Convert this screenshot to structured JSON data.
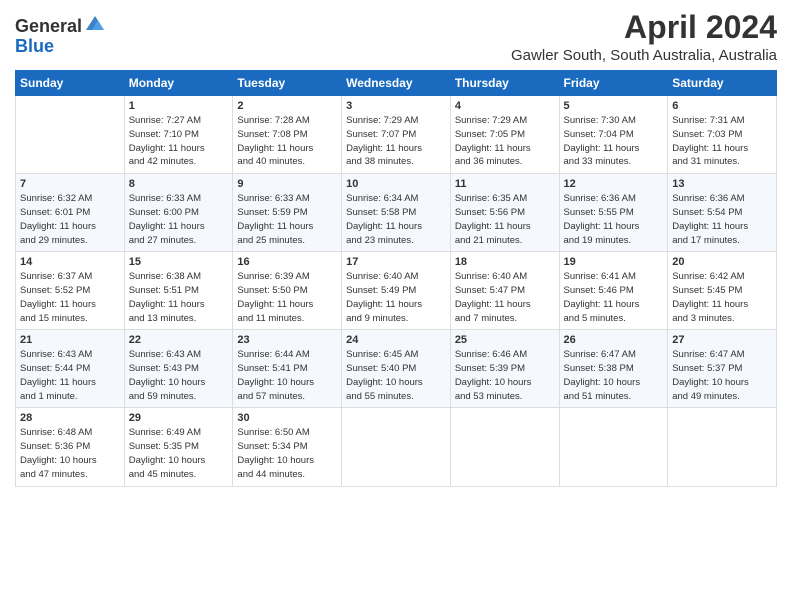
{
  "logo": {
    "general": "General",
    "blue": "Blue"
  },
  "title": "April 2024",
  "subtitle": "Gawler South, South Australia, Australia",
  "headers": [
    "Sunday",
    "Monday",
    "Tuesday",
    "Wednesday",
    "Thursday",
    "Friday",
    "Saturday"
  ],
  "weeks": [
    [
      {
        "day": "",
        "info": ""
      },
      {
        "day": "1",
        "info": "Sunrise: 7:27 AM\nSunset: 7:10 PM\nDaylight: 11 hours\nand 42 minutes."
      },
      {
        "day": "2",
        "info": "Sunrise: 7:28 AM\nSunset: 7:08 PM\nDaylight: 11 hours\nand 40 minutes."
      },
      {
        "day": "3",
        "info": "Sunrise: 7:29 AM\nSunset: 7:07 PM\nDaylight: 11 hours\nand 38 minutes."
      },
      {
        "day": "4",
        "info": "Sunrise: 7:29 AM\nSunset: 7:05 PM\nDaylight: 11 hours\nand 36 minutes."
      },
      {
        "day": "5",
        "info": "Sunrise: 7:30 AM\nSunset: 7:04 PM\nDaylight: 11 hours\nand 33 minutes."
      },
      {
        "day": "6",
        "info": "Sunrise: 7:31 AM\nSunset: 7:03 PM\nDaylight: 11 hours\nand 31 minutes."
      }
    ],
    [
      {
        "day": "7",
        "info": "Sunrise: 6:32 AM\nSunset: 6:01 PM\nDaylight: 11 hours\nand 29 minutes."
      },
      {
        "day": "8",
        "info": "Sunrise: 6:33 AM\nSunset: 6:00 PM\nDaylight: 11 hours\nand 27 minutes."
      },
      {
        "day": "9",
        "info": "Sunrise: 6:33 AM\nSunset: 5:59 PM\nDaylight: 11 hours\nand 25 minutes."
      },
      {
        "day": "10",
        "info": "Sunrise: 6:34 AM\nSunset: 5:58 PM\nDaylight: 11 hours\nand 23 minutes."
      },
      {
        "day": "11",
        "info": "Sunrise: 6:35 AM\nSunset: 5:56 PM\nDaylight: 11 hours\nand 21 minutes."
      },
      {
        "day": "12",
        "info": "Sunrise: 6:36 AM\nSunset: 5:55 PM\nDaylight: 11 hours\nand 19 minutes."
      },
      {
        "day": "13",
        "info": "Sunrise: 6:36 AM\nSunset: 5:54 PM\nDaylight: 11 hours\nand 17 minutes."
      }
    ],
    [
      {
        "day": "14",
        "info": "Sunrise: 6:37 AM\nSunset: 5:52 PM\nDaylight: 11 hours\nand 15 minutes."
      },
      {
        "day": "15",
        "info": "Sunrise: 6:38 AM\nSunset: 5:51 PM\nDaylight: 11 hours\nand 13 minutes."
      },
      {
        "day": "16",
        "info": "Sunrise: 6:39 AM\nSunset: 5:50 PM\nDaylight: 11 hours\nand 11 minutes."
      },
      {
        "day": "17",
        "info": "Sunrise: 6:40 AM\nSunset: 5:49 PM\nDaylight: 11 hours\nand 9 minutes."
      },
      {
        "day": "18",
        "info": "Sunrise: 6:40 AM\nSunset: 5:47 PM\nDaylight: 11 hours\nand 7 minutes."
      },
      {
        "day": "19",
        "info": "Sunrise: 6:41 AM\nSunset: 5:46 PM\nDaylight: 11 hours\nand 5 minutes."
      },
      {
        "day": "20",
        "info": "Sunrise: 6:42 AM\nSunset: 5:45 PM\nDaylight: 11 hours\nand 3 minutes."
      }
    ],
    [
      {
        "day": "21",
        "info": "Sunrise: 6:43 AM\nSunset: 5:44 PM\nDaylight: 11 hours\nand 1 minute."
      },
      {
        "day": "22",
        "info": "Sunrise: 6:43 AM\nSunset: 5:43 PM\nDaylight: 10 hours\nand 59 minutes."
      },
      {
        "day": "23",
        "info": "Sunrise: 6:44 AM\nSunset: 5:41 PM\nDaylight: 10 hours\nand 57 minutes."
      },
      {
        "day": "24",
        "info": "Sunrise: 6:45 AM\nSunset: 5:40 PM\nDaylight: 10 hours\nand 55 minutes."
      },
      {
        "day": "25",
        "info": "Sunrise: 6:46 AM\nSunset: 5:39 PM\nDaylight: 10 hours\nand 53 minutes."
      },
      {
        "day": "26",
        "info": "Sunrise: 6:47 AM\nSunset: 5:38 PM\nDaylight: 10 hours\nand 51 minutes."
      },
      {
        "day": "27",
        "info": "Sunrise: 6:47 AM\nSunset: 5:37 PM\nDaylight: 10 hours\nand 49 minutes."
      }
    ],
    [
      {
        "day": "28",
        "info": "Sunrise: 6:48 AM\nSunset: 5:36 PM\nDaylight: 10 hours\nand 47 minutes."
      },
      {
        "day": "29",
        "info": "Sunrise: 6:49 AM\nSunset: 5:35 PM\nDaylight: 10 hours\nand 45 minutes."
      },
      {
        "day": "30",
        "info": "Sunrise: 6:50 AM\nSunset: 5:34 PM\nDaylight: 10 hours\nand 44 minutes."
      },
      {
        "day": "",
        "info": ""
      },
      {
        "day": "",
        "info": ""
      },
      {
        "day": "",
        "info": ""
      },
      {
        "day": "",
        "info": ""
      }
    ]
  ]
}
